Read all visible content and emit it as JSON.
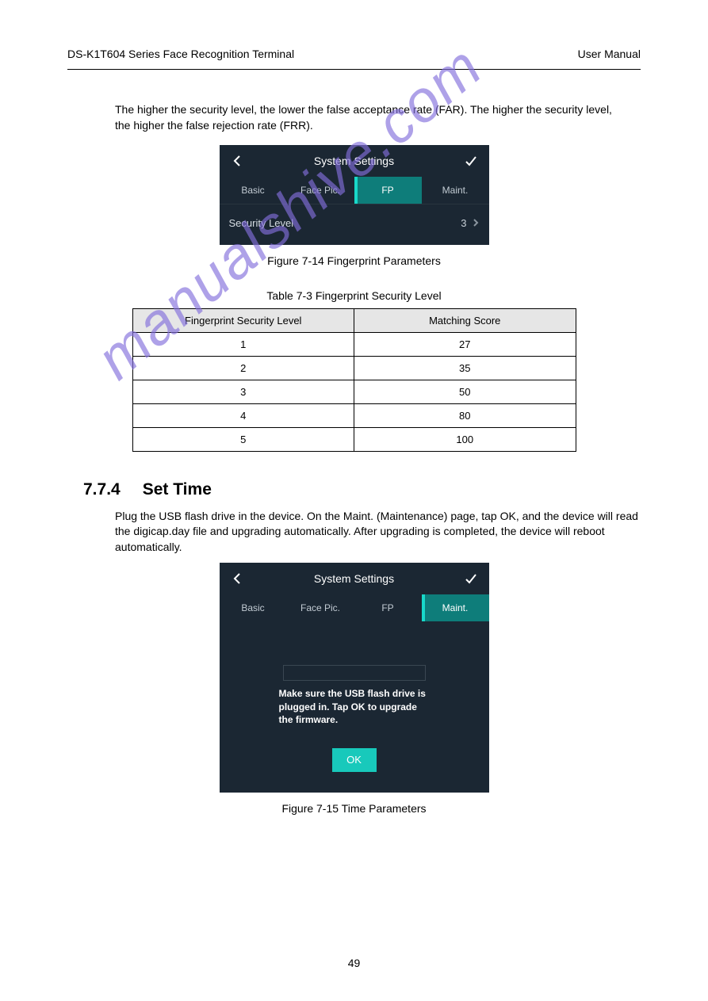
{
  "header": {
    "left": "DS-K1T604 Series Face Recognition Terminal",
    "right": "User Manual"
  },
  "footer": "49",
  "watermark": "manualshive.com",
  "intro": "The higher the security level, the lower the false acceptance rate (FAR). The higher the security level, the higher the false rejection rate (FRR).",
  "shot1": {
    "title": "System Settings",
    "tabs": [
      "Basic",
      "Face Pic.",
      "FP",
      "Maint."
    ],
    "active_tab": "FP",
    "row_label": "Security Level",
    "row_value": "3"
  },
  "fig1_caption": "Figure 7-14 Fingerprint Parameters",
  "tab_caption": "Table 7-3 Fingerprint Security Level",
  "table": {
    "headers": [
      "Fingerprint Security Level",
      "Matching Score"
    ],
    "rows": [
      [
        "1",
        "27"
      ],
      [
        "2",
        "35"
      ],
      [
        "3",
        "50"
      ],
      [
        "4",
        "80"
      ],
      [
        "5",
        "100"
      ]
    ]
  },
  "section": {
    "number": "7.7.4",
    "title": "Set Time"
  },
  "p2": "Plug the USB flash drive in the device. On the Maint. (Maintenance) page, tap OK, and the device will read the digicap.day file and upgrading automatically. After upgrading is completed, the device will reboot automatically.",
  "shot2": {
    "title": "System Settings",
    "tabs": [
      "Basic",
      "Face Pic.",
      "FP",
      "Maint."
    ],
    "active_tab": "Maint.",
    "message": "Make sure the USB flash drive is plugged in. Tap OK to upgrade the firmware.",
    "ok": "OK"
  },
  "fig2_caption": "Figure 7-15 Time Parameters"
}
